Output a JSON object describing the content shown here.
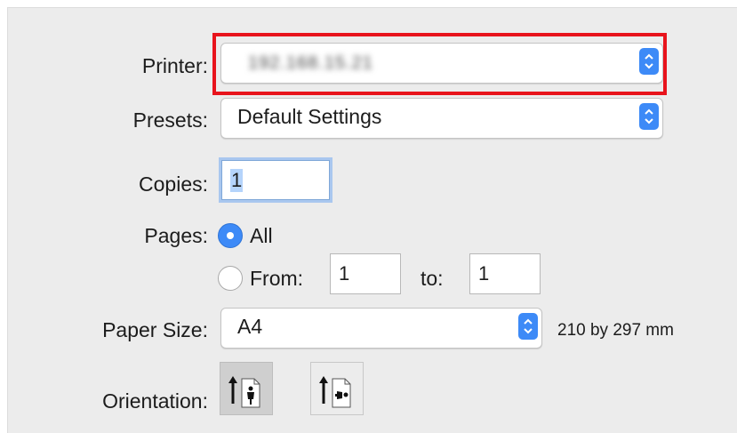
{
  "printer": {
    "label": "Printer:",
    "value": "192.168.15.21"
  },
  "presets": {
    "label": "Presets:",
    "value": "Default Settings"
  },
  "copies": {
    "label": "Copies:",
    "value": "1"
  },
  "pages": {
    "label": "Pages:",
    "all_label": "All",
    "from_label": "From:",
    "from_value": "1",
    "to_label": "to:",
    "to_value": "1",
    "selected": "All"
  },
  "paper_size": {
    "label": "Paper Size:",
    "value": "A4",
    "dimensions": "210 by 297 mm"
  },
  "orientation": {
    "label": "Orientation:",
    "selected": "portrait"
  },
  "colors": {
    "accent": "#3d8af7",
    "highlight": "#e8141c",
    "background": "#ececec"
  }
}
